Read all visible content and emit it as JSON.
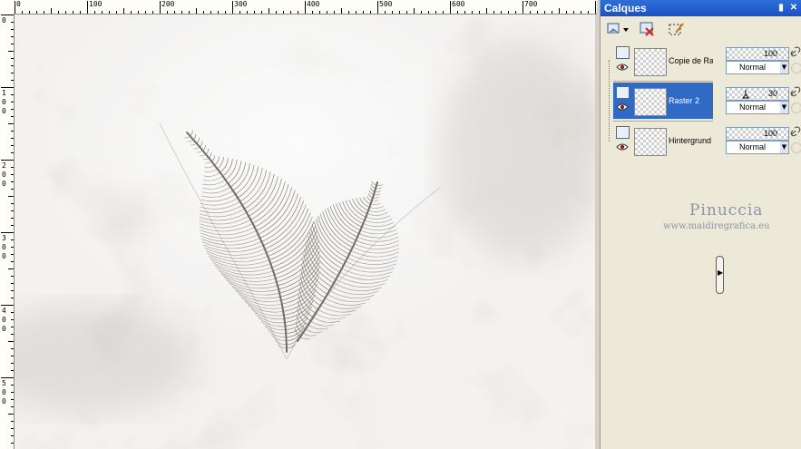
{
  "rulers": {
    "horizontal_labels": [
      "0",
      "100",
      "200",
      "300",
      "400",
      "500",
      "600",
      "700"
    ],
    "vertical_labels": [
      "0",
      "1\n0\n0",
      "2\n0\n0",
      "3\n0\n0",
      "4\n0\n0",
      "5\n0\n0"
    ]
  },
  "panel": {
    "title": "Calques",
    "pin_icon": "pin-icon",
    "close_icon": "close-icon",
    "toolbar": [
      {
        "name": "new-layer-button",
        "icon": "new-layer-icon"
      },
      {
        "name": "delete-layer-button",
        "icon": "delete-layer-icon"
      },
      {
        "name": "edit-selection-button",
        "icon": "edit-selection-icon"
      }
    ],
    "layers": [
      {
        "name": "Copie de Ra",
        "opacity": "100",
        "blend": "Normal",
        "selected": false
      },
      {
        "name": "Raster 2",
        "opacity": "30",
        "blend": "Normal",
        "selected": true
      },
      {
        "name": "Hintergrund",
        "opacity": "100",
        "blend": "Normal",
        "selected": false
      }
    ]
  },
  "watermark": {
    "name": "Pinuccia",
    "url": "www.maidiregrafica.eu"
  },
  "colors": {
    "title_bar": "#1951c5",
    "selection": "#316ac5",
    "panel_bg": "#ece9d8",
    "feather": "#7b746b"
  }
}
